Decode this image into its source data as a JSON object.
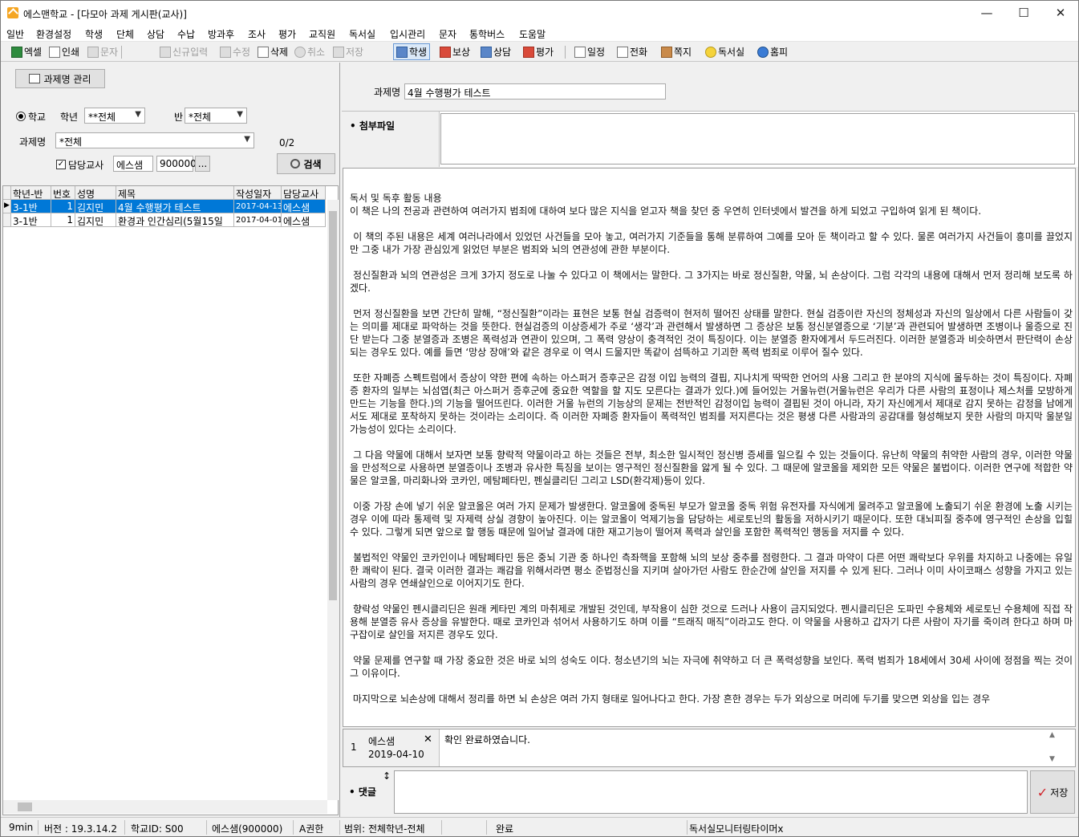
{
  "window": {
    "title": "에스맨학교 - [다모아 과제 게시판(교사)]",
    "minimize": "—",
    "maximize": "☐",
    "close": "✕"
  },
  "menu": [
    "일반",
    "환경설정",
    "학생",
    "단체",
    "상담",
    "수납",
    "방과후",
    "조사",
    "평가",
    "교직원",
    "독서실",
    "입시관리",
    "문자",
    "통학버스",
    "도움말"
  ],
  "toolbar": {
    "excel": "엑셀",
    "print": "인쇄",
    "sms": "문자",
    "new": "신규입력",
    "edit": "수정",
    "delete": "삭제",
    "cancel": "취소",
    "save": "저장",
    "student": "학생",
    "reward": "보상",
    "counsel": "상담",
    "evaluate": "평가",
    "schedule": "일정",
    "phone": "전화",
    "note": "쪽지",
    "study_room": "독서실",
    "homepage": "홈피"
  },
  "left": {
    "manage_button": "과제명 관리",
    "radio_school": "학교",
    "grade_label": "학년",
    "grade_value": "**전체",
    "class_label": "반",
    "class_value": "*전체",
    "task_label": "과제명",
    "task_value": "*전체",
    "count": "0/2",
    "teacher_check_label": "담당교사",
    "teacher_name": "에스샘",
    "teacher_id": "900000",
    "dots": "...",
    "search_button": "검색",
    "columns": [
      "학년-반",
      "번호",
      "성명",
      "제목",
      "작성일자",
      "담당교사"
    ],
    "rows": [
      {
        "grade": "3-1반",
        "num": "1",
        "name": "김지민",
        "title": "4월 수행평가 테스트",
        "date": "2017-04-13",
        "teacher": "에스샘"
      },
      {
        "grade": "3-1반",
        "num": "1",
        "name": "김지민",
        "title": "환경과 인간심리(5월15일",
        "date": "2017-04-01",
        "teacher": "에스샘"
      }
    ]
  },
  "right": {
    "task_label": "과제명",
    "task_value": "4월 수행평가 테스트",
    "attach_label": "첨부파일",
    "paragraphs": [
      "독서 및 독후 활동 내용\n이 책은 나의 전공과 관련하여 여러가지 범죄에 대하여 보다 많은 지식을 얻고자 책을 찾던 중 우연히 인터넷에서 발견을 하게 되었고 구입하여 읽게 된 책이다.",
      " 이 책의 주된 내용은 세계 여러나라에서 있었던 사건들을 모아 놓고, 여러가지 기준들을 통해 분류하여 그예를 모아 둔 책이라고 할 수 있다. 물론 여러가지 사건들이 흥미를 끌었지만 그중 내가 가장 관심있게 읽었던 부분은 범죄와 뇌의 연관성에 관한 부분이다.",
      " 정신질환과 뇌의 연관성은 크게 3가지 정도로 나눌 수 있다고 이 책에서는 말한다. 그 3가지는 바로 정신질환, 약물, 뇌 손상이다. 그럼 각각의 내용에 대해서 먼저 정리해 보도록 하겠다.",
      " 먼저 정신질환을 보면 간단히 말해, “정신질환”이라는 표현은 보통 현실 검증력이 현저히 떨어진 상태를 말한다. 현실 검증이란 자신의 정체성과 자신의 일상에서 다른 사람들이 갖는 의미를 제대로 파악하는 것을 뜻한다. 현실검증의 이상증세가 주로 ‘생각’과 관련해서 발생하면 그 증상은 보통 정신분열증으로 ‘기분’과 관련되어 발생하면 조병이나 울증으로 진단 받는다 그중 분열증과 조병은 폭력성과 연관이 있으며, 그 폭력 양상이 충격적인 것이 특징이다. 이는 분열증 환자에게서 두드러진다. 이러한 분열증과 비슷하면서 판단력이 손상되는 경우도 있다. 예를 들면 ‘망상 장애’와 같은 경우로 이 역시 드물지만 똑같이 섬뜩하고 기괴한 폭력 범죄로 이루어 질수 있다.",
      " 또한 자폐증 스펙트럼에서 증상이 약한 편에 속하는 아스퍼거 증후군은 감정 이입 능력의 결핍, 지나치게 딱딱한 언어의 사용 그리고 한 분야의 지식에 몰두하는 것이 특징이다. 자폐증 환자의 일부는 뇌섬엽(최근 아스퍼거 증후군에 중요한 역할을 할 지도 모른다는 결과가 있다.)에 들어있는 거울뉴런(거울뉴런은 우리가 다른 사람의 표정이나 제스처를 모방하게 만드는 기능을 한다.)의 기능을 떨어뜨린다. 이러한 거울 뉴런의 기능상의 문제는 전반적인 감정이입 능력이 결핍된 것이 아니라, 자기 자신에게서 제대로 감지 못하는 감정을 남에게서도 제대로 포착하지 못하는 것이라는 소리이다. 즉 이러한 자폐증 환자들이 폭력적인 범죄를 저지른다는 것은 평생 다른 사람과의 공감대를 형성해보지 못한 사람의 마지막 울분일 가능성이 있다는 소리이다.",
      " 그 다음 약물에 대해서 보자면 보통 향락적 약물이라고 하는 것들은 전부, 최소한 일시적인 정신병 증세를 일으킬 수 있는 것들이다. 유난히 약물의 취약한 사람의 경우, 이러한 약물을 만성적으로 사용하면 분열증이나 조병과 유사한 특징을 보이는 영구적인 정신질환을 앓게 될 수 있다. 그 때문에 알코올을 제외한 모든 약물은 불법이다. 이러한 연구에 적합한 약물은 알코올, 마리화나와 코카인, 메탐페타민, 펜실클리딘 그리고 LSD(환각제)등이 있다.",
      " 이중 가장 손에 넣기 쉬운 알코올은 여러 가지 문제가 발생한다. 알코올에 중독된 부모가 알코올 중독 위험 유전자를 자식에게 물려주고 알코올에 노출되기 쉬운 환경에 노출 시키는 경우 이에 따라 통제력 및 자제력 상실 경향이 높아진다. 이는 알코올이 억제기능을 담당하는 세로토닌의 활동을 저하시키기 때문이다. 또한 대뇌피질 중추에 영구적인 손상을 입힐 수 있다. 그렇게 되면 앞으로 할 행동 때문에 일어날 결과에 대한 재고기능이 떨어져 폭력과 살인을 포함한 폭력적인 행동을 저지를 수 있다.",
      " 불법적인 약물인 코카인이나 메탐페타민 등은 중뇌 기관 중 하나인 측좌핵을 포함해 뇌의 보상 중추를 점령한다. 그 결과 마약이 다른 어떤 쾌락보다 우위를 차지하고 나중에는 유일한 쾌락이 된다. 결국 이러한 결과는 쾌감을 위해서라면 평소 준법정신을 지키며 살아가던 사람도 한순간에 살인을 저지를 수 있게 된다. 그러나 이미 사이코패스 성향을 가지고 있는 사람의 경우 연쇄살인으로 이어지기도 한다.",
      " 향락성 약물인 펜시클리딘은 원래 케타민 계의 마취제로 개발된 것인데, 부작용이 심한 것으로 드러나 사용이 금지되었다. 펜시클리딘은 도파민 수용체와 세로토닌 수용체에 직접 작용해 분열증 유사 증상을 유발한다. 때로 코카인과 섞어서 사용하기도 하며 이를 “트래직 매직”이라고도 한다. 이 약물을 사용하고 갑자기 다른 사람이 자기를 죽이려 한다고 하며 마구잡이로 살인을 저지른 경우도 있다.",
      " 약물 문제를 연구할 때 가장 중요한 것은 바로 뇌의 성숙도 이다. 청소년기의 뇌는 자극에 취약하고 더 큰 폭력성향을 보인다. 폭력 범죄가 18세에서 30세 사이에 정점을 찍는 것이 그 이유이다.",
      " 마지막으로 뇌손상에 대해서 정리를 하면 뇌 손상은 여러 가지 형태로 일어나다고 한다. 가장 흔한 경우는 두가 외상으로 머리에 두기를 맞으면 외상을 입는 경우"
    ],
    "comment": {
      "index": "1",
      "author": "에스샘",
      "date": "2019-04-10",
      "delete": "✕",
      "text": "확인 완료하였습니다."
    },
    "reply_label": "댓글",
    "reply_resize": "↕",
    "save_button": "저장"
  },
  "status": {
    "timer": "9min",
    "version": "버전 : 19.3.14.2",
    "school_id": "학교ID: S00",
    "user": "에스샘(900000)",
    "auth": "A권한",
    "scope": "범위: 전체학년-전체",
    "done": "완료",
    "monitor": "독서실모니터링타이머x"
  },
  "colors": {
    "selection": "#0078d7",
    "accent_red": "#d0242b"
  }
}
